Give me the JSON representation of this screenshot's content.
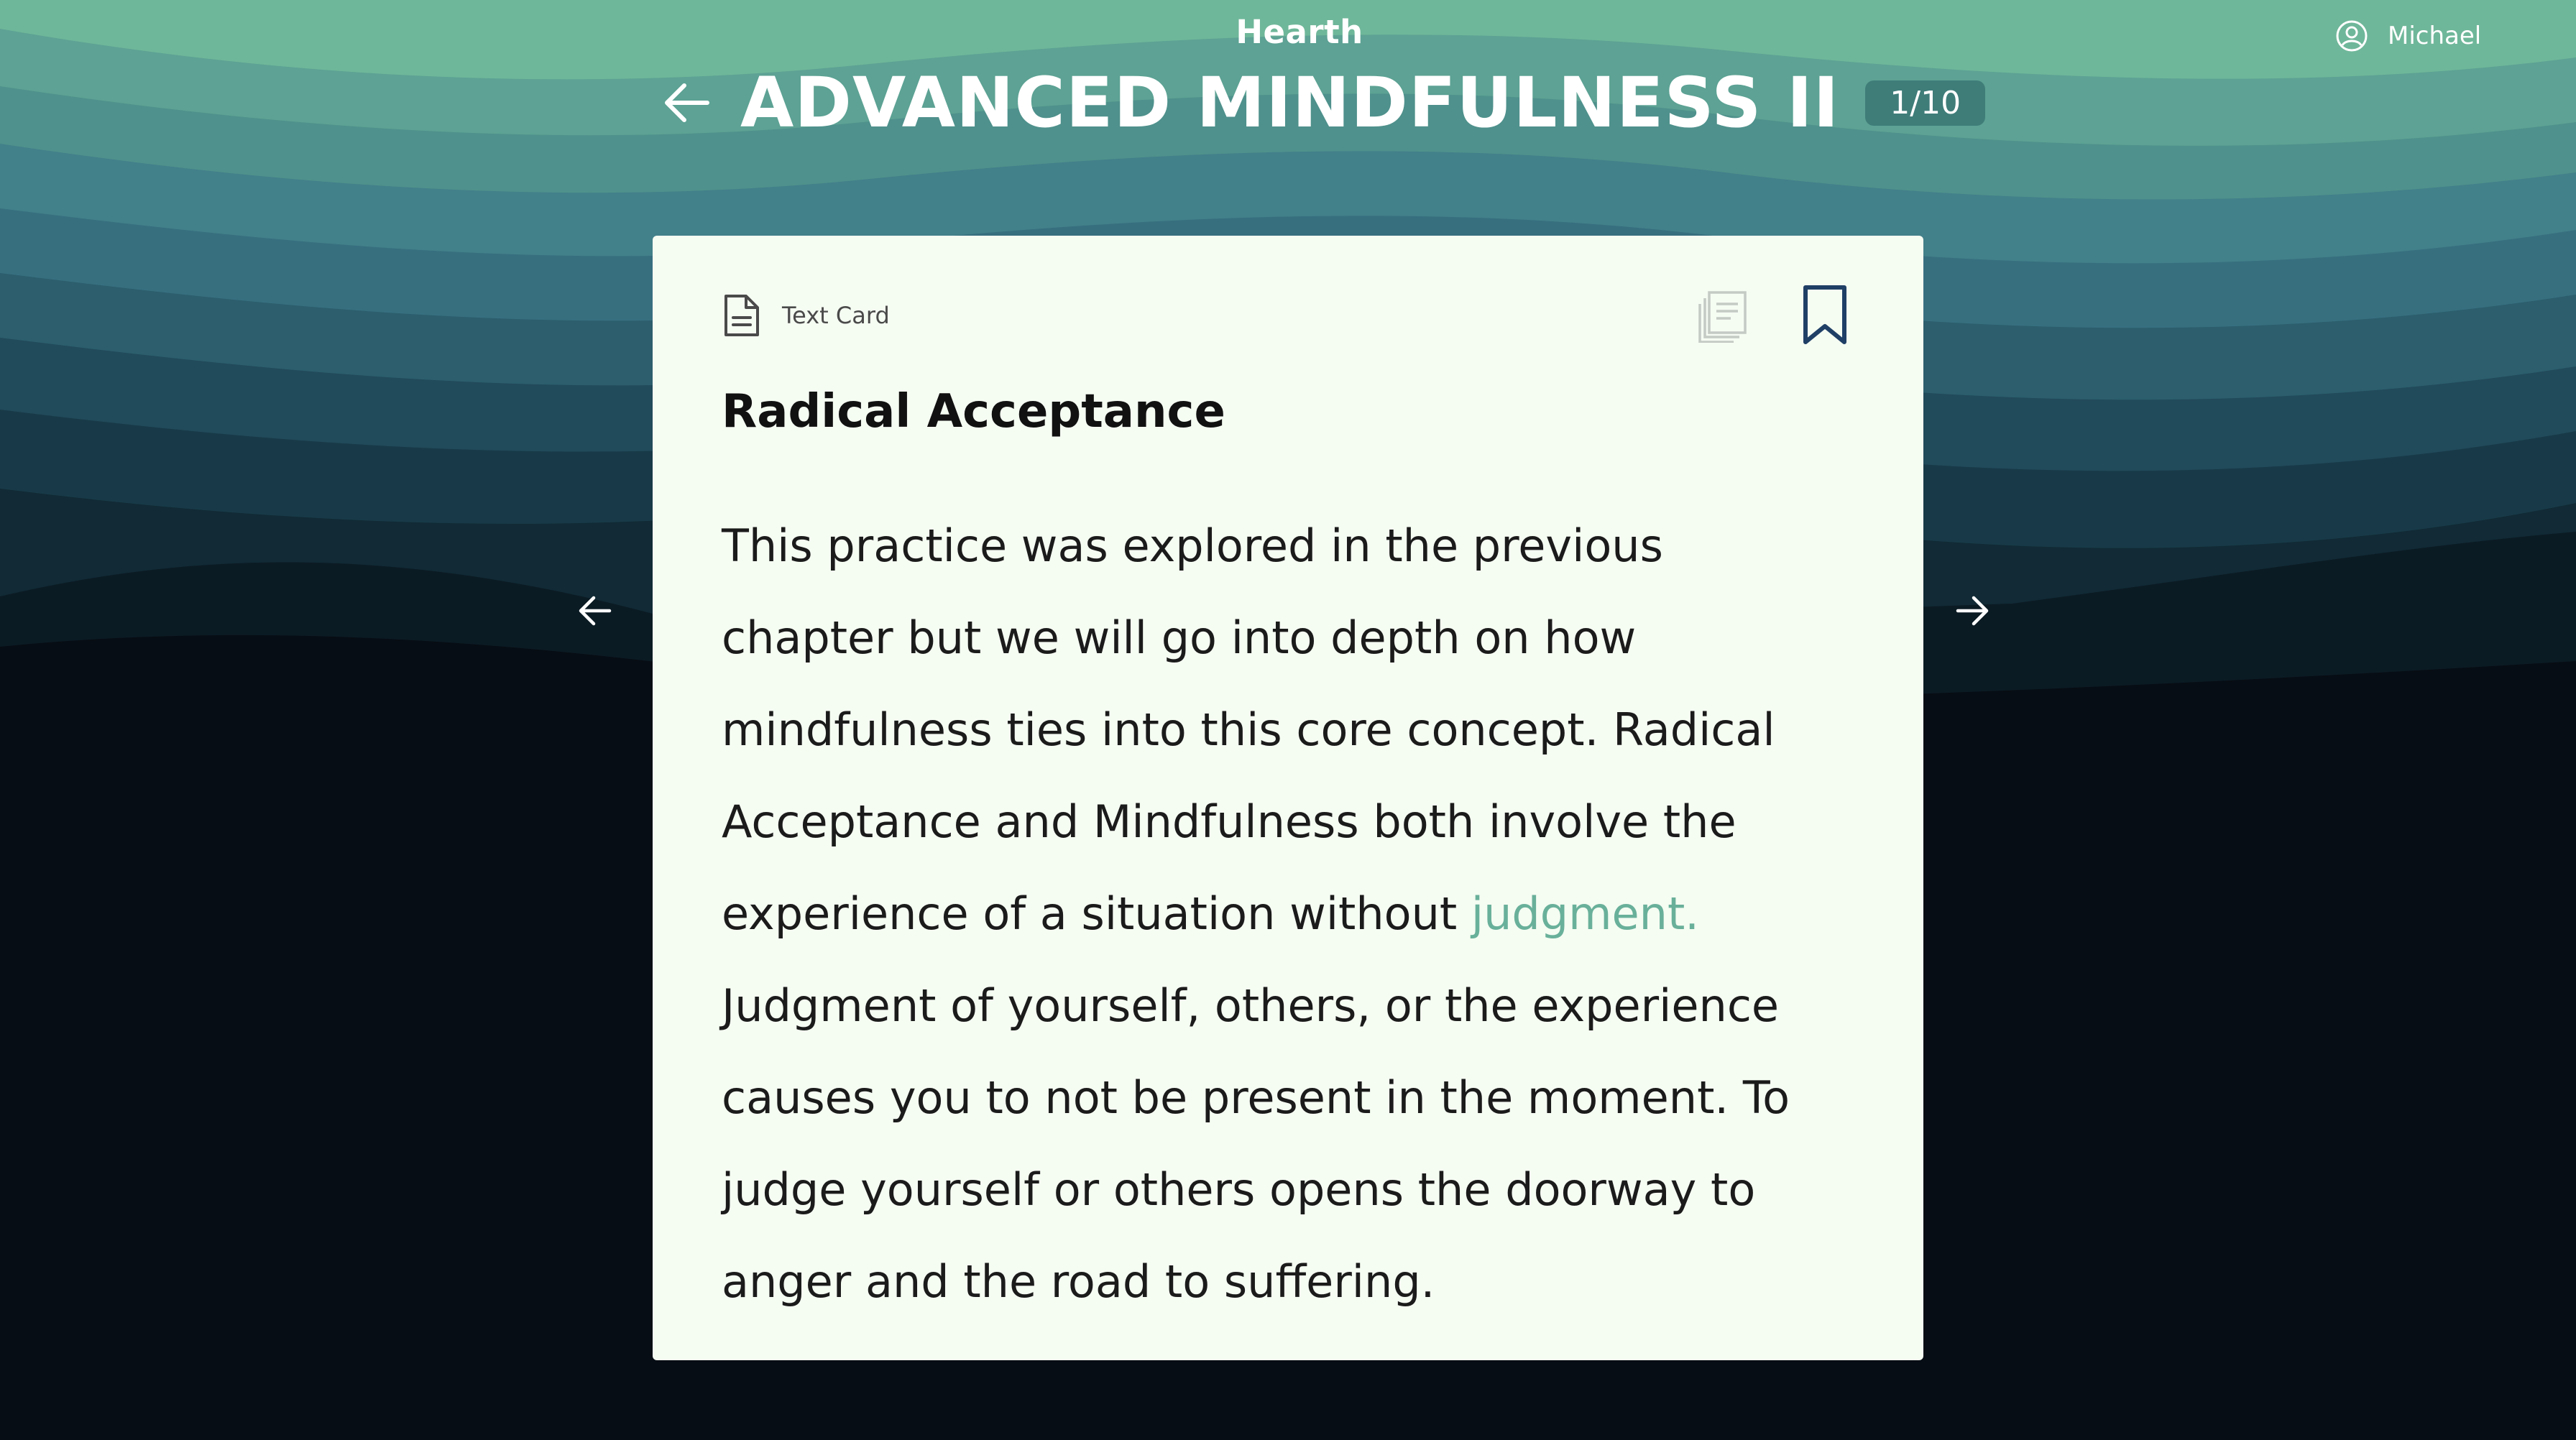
{
  "app": {
    "brand": "Hearth"
  },
  "user": {
    "name": "Michael",
    "icon": "user-circle-icon"
  },
  "header": {
    "back_icon": "arrow-left-icon",
    "title": "ADVANCED MINDFULNESS II",
    "progress": "1/10"
  },
  "card": {
    "type_icon": "document-icon",
    "type_label": "Text Card",
    "notes_icon": "notes-icon",
    "bookmark_icon": "bookmark-icon",
    "title": "Radical Acceptance",
    "body_lines": [
      "This practice was explored in the previous",
      "chapter but we will go into depth on how",
      "mindfulness ties into this core concept. Radical",
      "Acceptance and Mindfulness both involve the",
      "experience of a situation without ",
      "Judgment of yourself, others, or the experience",
      "causes you to not be present in the moment. To",
      "judge yourself or others opens the doorway to",
      "anger and the road to suffering."
    ],
    "highlight_word": "judgment."
  },
  "navigation": {
    "prev_icon": "arrow-left-icon",
    "next_icon": "arrow-right-icon"
  },
  "colors": {
    "accent": "#69b09a",
    "card_background": "#f5fcf2",
    "page_background": "#070d14",
    "bookmark": "#1f3f66"
  }
}
